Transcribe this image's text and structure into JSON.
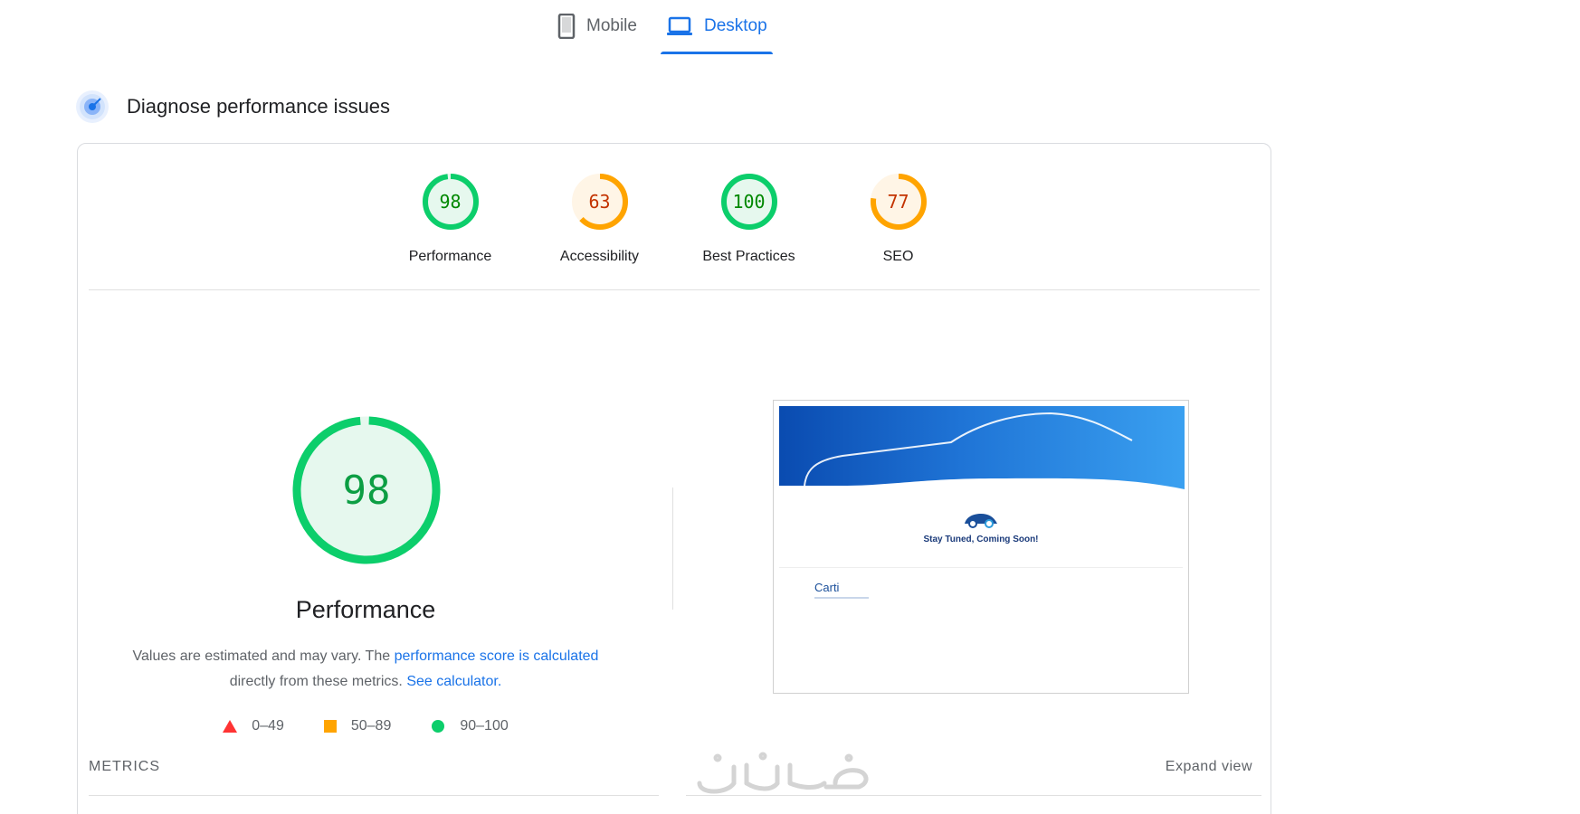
{
  "tabs": [
    {
      "label": "Mobile",
      "icon": "phone-icon",
      "active": false
    },
    {
      "label": "Desktop",
      "icon": "laptop-icon",
      "active": true
    }
  ],
  "section": {
    "title": "Diagnose performance issues",
    "icon": "diagnose-icon"
  },
  "categories": [
    {
      "label": "Performance",
      "score": "98",
      "fraction": 0.98,
      "color": "#0cce6b",
      "text_color": "#008800",
      "fill": "#e6f8ee"
    },
    {
      "label": "Accessibility",
      "score": "63",
      "fraction": 0.63,
      "color": "#ffa400",
      "text_color": "#c33300",
      "fill": "#fff5e6"
    },
    {
      "label": "Best Practices",
      "score": "100",
      "fraction": 1.0,
      "color": "#0cce6b",
      "text_color": "#008800",
      "fill": "#e6f8ee"
    },
    {
      "label": "SEO",
      "score": "77",
      "fraction": 0.77,
      "color": "#ffa400",
      "text_color": "#c33300",
      "fill": "#fff5e6"
    }
  ],
  "performance": {
    "score": "98",
    "fraction": 0.98,
    "title": "Performance",
    "desc_prefix": "Values are estimated and may vary. The ",
    "desc_link1": "performance score is calculated",
    "desc_middle": " directly from these metrics. ",
    "desc_link2": "See calculator.",
    "legend": [
      {
        "range": "0–49",
        "shape": "triangle",
        "color": "#ff3333"
      },
      {
        "range": "50–89",
        "shape": "square",
        "color": "#ffa400"
      },
      {
        "range": "90–100",
        "shape": "circle",
        "color": "#0cce6b"
      }
    ]
  },
  "screenshot": {
    "tagline": "Stay Tuned, Coming Soon!",
    "brand": "Carti"
  },
  "metrics": {
    "label": "METRICS",
    "expand_label": "Expand view"
  },
  "watermark": {
    "text": "خمسات"
  }
}
